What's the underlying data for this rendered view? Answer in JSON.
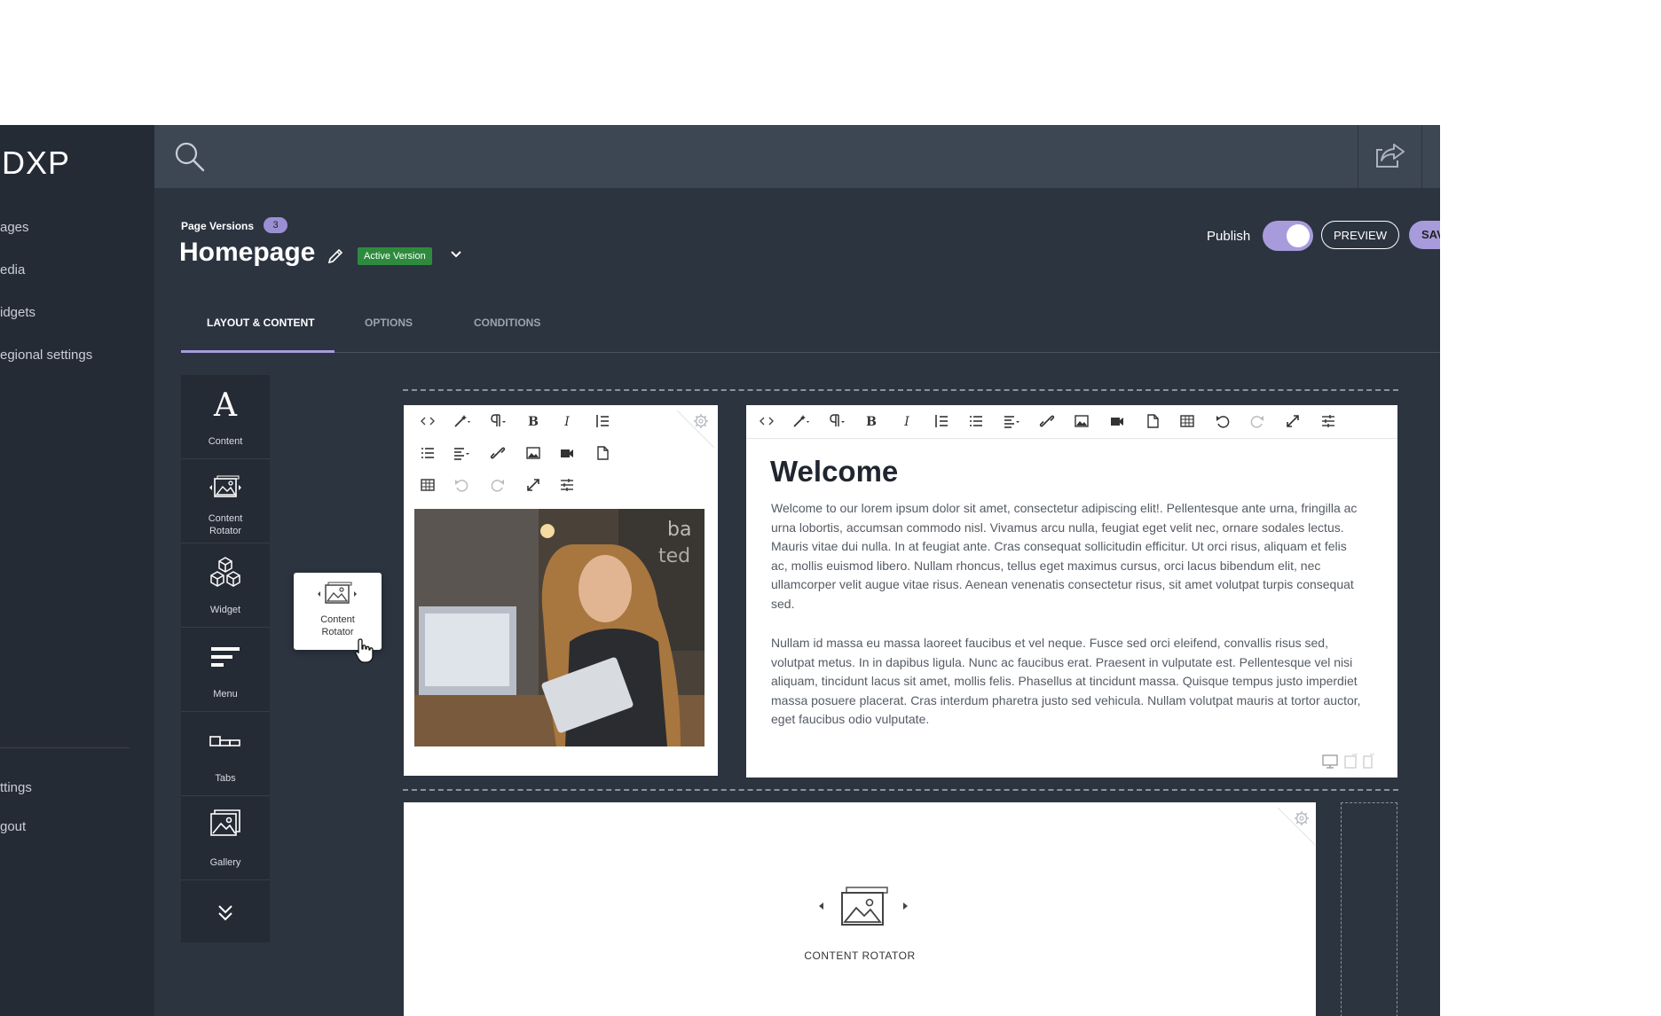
{
  "sidebar": {
    "logo": "DXP",
    "items": [
      "ages",
      "edia",
      "idgets",
      "egional settings"
    ],
    "bottom_items": [
      "ttings",
      "gout"
    ]
  },
  "header": {
    "page_versions_label": "Page Versions",
    "page_versions_count": "3",
    "title": "Homepage",
    "version_badge": "Active Version",
    "publish_label": "Publish",
    "publish_on": true,
    "preview_label": "PREVIEW",
    "save_label": "SAV"
  },
  "tabs": [
    {
      "label": "LAYOUT & CONTENT",
      "active": true
    },
    {
      "label": "OPTIONS",
      "active": false
    },
    {
      "label": "CONDITIONS",
      "active": false
    }
  ],
  "palette": [
    {
      "label": "Content",
      "icon": "letter-a-icon"
    },
    {
      "label": "Content\nRotator",
      "icon": "content-rotator-icon"
    },
    {
      "label": "Widget",
      "icon": "cubes-icon"
    },
    {
      "label": "Menu",
      "icon": "menu-lines-icon"
    },
    {
      "label": "Tabs",
      "icon": "tabs-icon"
    },
    {
      "label": "Gallery",
      "icon": "gallery-icon"
    }
  ],
  "drag_card": {
    "label": "Content Rotator"
  },
  "editor": {
    "heading": "Welcome",
    "paragraph1": "Welcome to our lorem ipsum dolor sit amet, consectetur adipiscing elit!. Pellentesque ante urna, fringilla ac urna lobortis, accumsan commodo nisl. Vivamus arcu nulla, feugiat eget velit nec, ornare sodales lectus. Mauris vitae dui nulla. In at feugiat ante. Cras consequat sollicitudin efficitur. Ut orci risus, aliquam et felis ac, mollis euismod libero. Nullam rhoncus, tellus eget maximus cursus, orci lacus bibendum elit, nec ullamcorper velit augue vitae risus. Aenean venenatis consectetur risus, sit amet volutpat turpis consequat sed.",
    "paragraph2": "Nullam id massa eu massa laoreet faucibus et vel neque. Fusce sed orci eleifend, convallis risus sed, volutpat metus. In in dapibus ligula. Nunc ac faucibus erat. Praesent in vulputate est. Pellentesque vel nisi aliquam, tincidunt lacus sit amet, mollis felis. Phasellus at tincidunt massa. Quisque tempus justo imperdiet massa posuere placerat. Cras interdum pharetra justo sed vehicula. Nullam volutpat mauris at tortor auctor, eget faucibus odio vulputate."
  },
  "rotator_block": {
    "label": "CONTENT ROTATOR"
  },
  "colors": {
    "accent": "#a89bdc",
    "sidebar_bg": "#252b35",
    "app_bg": "#2c3440",
    "topbar_bg": "#3d4653",
    "badge_green": "#2e8b3e"
  }
}
